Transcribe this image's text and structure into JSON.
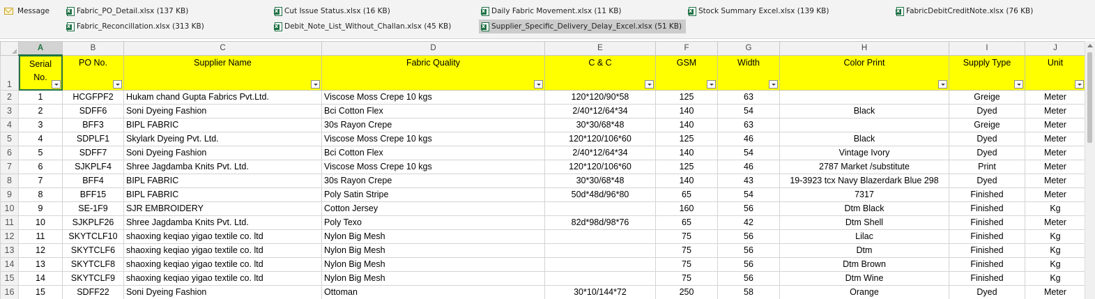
{
  "attachments": {
    "message_label": "Message",
    "files": [
      {
        "name": "Fabric_PO_Detail.xlsx (137 KB)"
      },
      {
        "name": "Cut Issue Status.xlsx (16 KB)"
      },
      {
        "name": "Daily Fabric Movement.xlsx (11 KB)"
      },
      {
        "name": "Stock Summary Excel.xlsx (139 KB)"
      },
      {
        "name": "FabricDebitCreditNote.xlsx (76 KB)"
      },
      {
        "name": "Fabric_Reconcillation.xlsx (313 KB)"
      },
      {
        "name": "Debit_Note_List_Without_Challan.xlsx (45 KB)"
      },
      {
        "name": "Supplier_Specific_Delivery_Delay_Excel.xlsx (51 KB)",
        "selected": true
      }
    ]
  },
  "sheet": {
    "column_letters": [
      "A",
      "B",
      "C",
      "D",
      "E",
      "F",
      "G",
      "H",
      "I",
      "J"
    ],
    "selected_column": "A",
    "header_row_number": "1",
    "headers": [
      "Serial No.",
      "PO No.",
      "Supplier Name",
      "Fabric Quality",
      "C & C",
      "GSM",
      "Width",
      "Color Print",
      "Supply Type",
      "Unit"
    ],
    "rows": [
      {
        "num": "2",
        "cells": [
          "1",
          "HCGFPF2",
          "Hukam chand Gupta Fabrics Pvt.Ltd.",
          "Viscose Moss Crepe 10 kgs",
          "120*120/90*58",
          "125",
          "63",
          "",
          "Greige",
          "Meter"
        ]
      },
      {
        "num": "3",
        "cells": [
          "2",
          "SDFF6",
          "Soni Dyeing Fashion",
          "Bci Cotton Flex",
          "2/40*12/64*34",
          "140",
          "54",
          "Black",
          "Dyed",
          "Meter"
        ]
      },
      {
        "num": "4",
        "cells": [
          "3",
          "BFF3",
          "BIPL FABRIC",
          "30s Rayon Crepe",
          "30*30/68*48",
          "140",
          "63",
          "",
          "Greige",
          "Meter"
        ]
      },
      {
        "num": "5",
        "cells": [
          "4",
          "SDPLF1",
          "Skylark Dyeing Pvt. Ltd.",
          "Viscose Moss Crepe 10 kgs",
          "120*120/106*60",
          "125",
          "46",
          "Black",
          "Dyed",
          "Meter"
        ]
      },
      {
        "num": "6",
        "cells": [
          "5",
          "SDFF7",
          "Soni Dyeing Fashion",
          "Bci Cotton Flex",
          "2/40*12/64*34",
          "140",
          "54",
          "Vintage Ivory",
          "Dyed",
          "Meter"
        ]
      },
      {
        "num": "7",
        "cells": [
          "6",
          "SJKPLF4",
          "Shree Jagdamba Knits Pvt.  Ltd.",
          "Viscose Moss Crepe 10 kgs",
          "120*120/106*60",
          "125",
          "46",
          "2787 Market /substitute",
          "Print",
          "Meter"
        ]
      },
      {
        "num": "8",
        "cells": [
          "7",
          "BFF4",
          "BIPL FABRIC",
          "30s Rayon Crepe",
          "30*30/68*48",
          "140",
          "43",
          "19-3923 tcx Navy Blazerdark Blue 298",
          "Dyed",
          "Meter"
        ]
      },
      {
        "num": "9",
        "cells": [
          "8",
          "BFF15",
          "BIPL FABRIC",
          "Poly Satin Stripe",
          "50d*48d/96*80",
          "65",
          "54",
          "7317",
          "Finished",
          "Meter"
        ]
      },
      {
        "num": "10",
        "cells": [
          "9",
          "SE-1F9",
          "SJR EMBROIDERY",
          "Cotton Jersey",
          "",
          "160",
          "56",
          "Dtm Black",
          "Finished",
          "Kg"
        ]
      },
      {
        "num": "11",
        "cells": [
          "10",
          "SJKPLF26",
          "Shree Jagdamba Knits Pvt.  Ltd.",
          "Poly Texo",
          "82d*98d/98*76",
          "65",
          "42",
          "Dtm Shell",
          "Finished",
          "Meter"
        ]
      },
      {
        "num": "12",
        "cells": [
          "11",
          "SKYTCLF10",
          "shaoxing keqiao yigao textile co. ltd",
          "Nylon Big Mesh",
          "",
          "75",
          "56",
          "Lilac",
          "Finished",
          "Kg"
        ]
      },
      {
        "num": "13",
        "cells": [
          "12",
          "SKYTCLF6",
          "shaoxing keqiao yigao textile co. ltd",
          "Nylon Big Mesh",
          "",
          "75",
          "56",
          "Dtm",
          "Finished",
          "Kg"
        ]
      },
      {
        "num": "14",
        "cells": [
          "13",
          "SKYTCLF8",
          "shaoxing keqiao yigao textile co. ltd",
          "Nylon Big Mesh",
          "",
          "75",
          "56",
          "Dtm Brown",
          "Finished",
          "Kg"
        ]
      },
      {
        "num": "15",
        "cells": [
          "14",
          "SKYTCLF9",
          "shaoxing keqiao yigao textile co. ltd",
          "Nylon Big Mesh",
          "",
          "75",
          "56",
          "Dtm Wine",
          "Finished",
          "Kg"
        ]
      },
      {
        "num": "16",
        "cells": [
          "15",
          "SDFF22",
          "Soni Dyeing Fashion",
          "Ottoman",
          "30*10/144*72",
          "250",
          "58",
          "Orange",
          "Dyed",
          "Meter"
        ]
      }
    ]
  },
  "colors": {
    "header_fill": "#ffff00",
    "excel_green": "#217346",
    "attach_bar": "#f3f3f3"
  },
  "icons": {
    "message": "mail-icon",
    "file": "excel-file-icon",
    "filter": "filter-dropdown-icon"
  }
}
